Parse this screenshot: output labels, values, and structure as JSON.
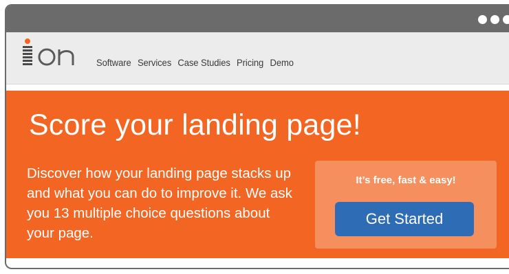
{
  "window": {
    "controls": [
      "dot",
      "dot",
      "dot"
    ]
  },
  "nav": {
    "logo_text": "ion",
    "items": [
      "Software",
      "Services",
      "Case Studies",
      "Pricing",
      "Demo"
    ]
  },
  "hero": {
    "title": "Score your landing page!",
    "description": "Discover how your landing page stacks up and what you can do to improve it. We ask you 13 multiple choice questions about your page.",
    "cta_tagline": "It’s free, fast & easy!",
    "cta_button": "Get Started"
  },
  "colors": {
    "hero_background": "#f26522",
    "cta_box": "#f58f5e",
    "cta_button": "#2e6db5",
    "titlebar": "#6b6b6b",
    "navbar": "#ececec"
  }
}
